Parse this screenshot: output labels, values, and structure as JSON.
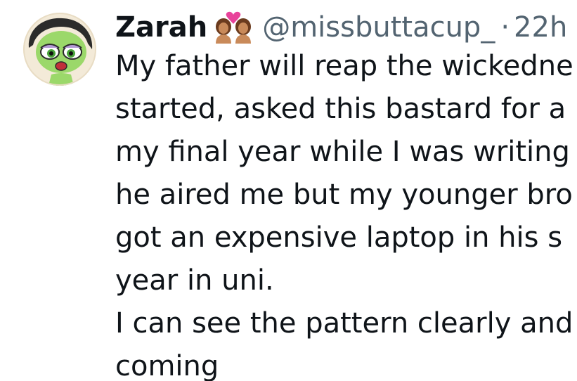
{
  "tweet": {
    "author_name": "Zarah",
    "author_emoji": "couple-with-heart-emoji",
    "handle": "@missbuttacup_",
    "separator": "·",
    "time": "22h",
    "lines": [
      "My father will reap the wickedne",
      "started, asked this bastard for a",
      "my final year while I was writing",
      "he aired me but my younger bro",
      "got an expensive laptop in his s",
      "year in uni.",
      "I can see the pattern clearly and",
      "coming"
    ]
  },
  "colors": {
    "name": "#0f1419",
    "meta": "#536471",
    "avatar_skin": "#9bd86a",
    "avatar_hair": "#2b2b2b",
    "avatar_bg": "#f3ead8"
  },
  "icons": {
    "avatar": "buttercup-cartoon-avatar",
    "emoji": "couple-with-heart-emoji"
  }
}
